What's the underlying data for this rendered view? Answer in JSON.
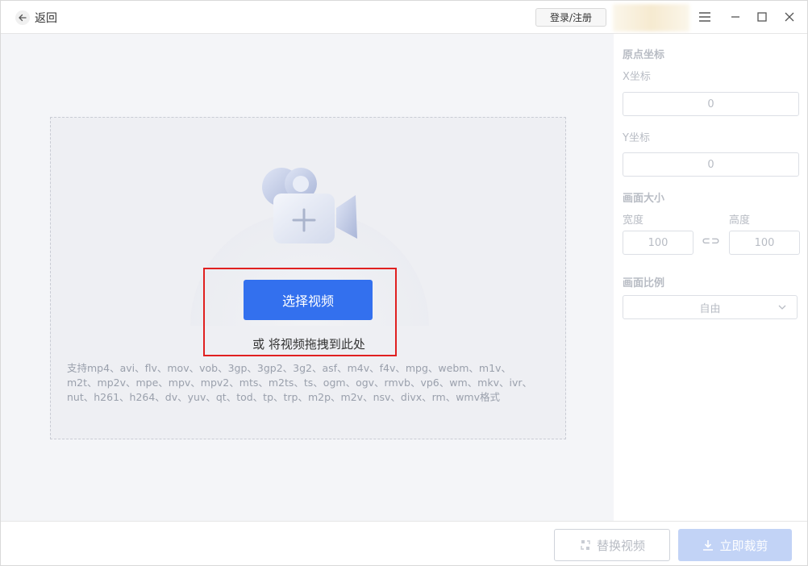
{
  "titlebar": {
    "back_label": "返回",
    "login_label": "登录/注册"
  },
  "icons": {
    "back": "arrow-left-icon",
    "menu": "hamburger-menu-icon",
    "minimize": "minimize-icon",
    "maximize": "maximize-icon",
    "close": "close-icon"
  },
  "dropzone": {
    "select_button": "选择视频",
    "drag_hint": "或 将视频拖拽到此处",
    "formats_lines": [
      "支持mp4、avi、flv、mov、vob、3gp、3gp2、3g2、asf、m4v、f4v、mpg、webm、m1v、",
      "m2t、mp2v、mpe、mpv、mpv2、mts、m2ts、ts、ogm、ogv、rmvb、vp6、wm、mkv、ivr、",
      "nut、h261、h264、dv、yuv、qt、tod、tp、trp、m2p、m2v、nsv、divx、rm、wmv格式"
    ]
  },
  "panel": {
    "origin_title": "原点坐标",
    "x_label": "X坐标",
    "x_value": "0",
    "y_label": "Y坐标",
    "y_value": "0",
    "size_title": "画面大小",
    "width_label": "宽度",
    "width_value": "100",
    "height_label": "高度",
    "height_value": "100",
    "ratio_title": "画面比例",
    "ratio_value": "自由"
  },
  "bottom": {
    "replace_label": "替换视频",
    "crop_label": "立即裁剪"
  },
  "colors": {
    "accent": "#3370ee",
    "disabled_accent": "#c2d3f6",
    "highlight_box": "#e02020"
  }
}
